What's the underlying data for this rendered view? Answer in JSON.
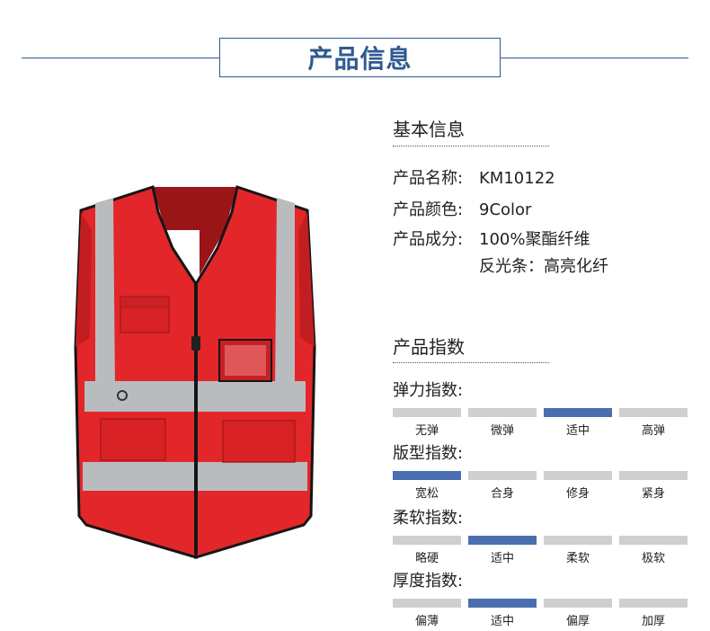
{
  "header": {
    "title": "产品信息"
  },
  "basic": {
    "title": "基本信息",
    "rows": [
      {
        "label": "产品名称:",
        "value": "KM10122"
      },
      {
        "label": "产品颜色:",
        "value": "9Color"
      },
      {
        "label": "产品成分:",
        "value": "100%聚酯纤维"
      }
    ],
    "extra": "反光条：高亮化纤"
  },
  "indices": {
    "title": "产品指数",
    "groups": [
      {
        "label": "弹力指数:",
        "options": [
          "无弹",
          "微弹",
          "适中",
          "高弹"
        ],
        "selected": 2
      },
      {
        "label": "版型指数:",
        "options": [
          "宽松",
          "合身",
          "修身",
          "紧身"
        ],
        "selected": 0
      },
      {
        "label": "柔软指数:",
        "options": [
          "略硬",
          "适中",
          "柔软",
          "极软"
        ],
        "selected": 1
      },
      {
        "label": "厚度指数:",
        "options": [
          "偏薄",
          "适中",
          "偏厚",
          "加厚"
        ],
        "selected": 1
      }
    ]
  },
  "colors": {
    "accent": "#2f5a8f",
    "bar_active": "#4a6eb0",
    "bar_inactive": "#cfcfcf",
    "vest_red": "#e3262a",
    "reflective": "#b9bcbe"
  }
}
